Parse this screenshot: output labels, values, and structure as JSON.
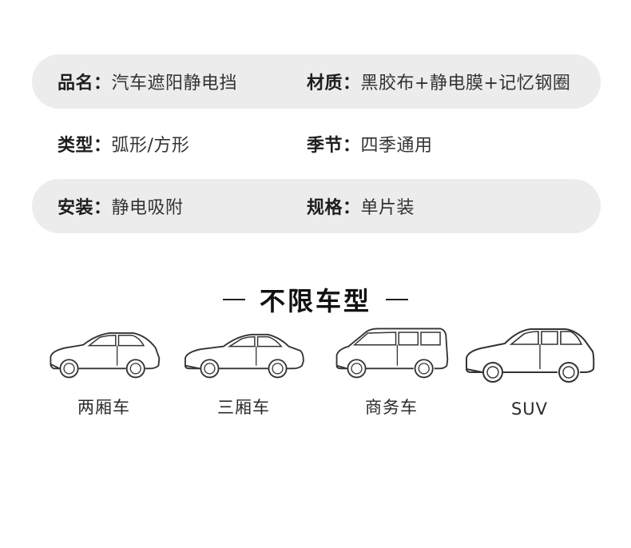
{
  "specs": [
    {
      "left": {
        "label": "品名：",
        "value": "汽车遮阳静电挡"
      },
      "right": {
        "label": "材质：",
        "value": "黑胶布+静电膜+记忆钢圈"
      }
    },
    {
      "left": {
        "label": "类型：",
        "value": "弧形/方形"
      },
      "right": {
        "label": "季节：",
        "value": "四季通用"
      }
    },
    {
      "left": {
        "label": "安装：",
        "value": "静电吸附"
      },
      "right": {
        "label": "规格：",
        "value": "单片装"
      }
    }
  ],
  "section": {
    "title": "不限车型"
  },
  "cars": [
    {
      "label": "两厢车",
      "icon": "hatchback-icon"
    },
    {
      "label": "三厢车",
      "icon": "sedan-icon"
    },
    {
      "label": "商务车",
      "icon": "mpv-icon"
    },
    {
      "label": "SUV",
      "icon": "suv-icon"
    }
  ],
  "colors": {
    "row_bg": "#ececec",
    "text": "#2b2b2b"
  }
}
